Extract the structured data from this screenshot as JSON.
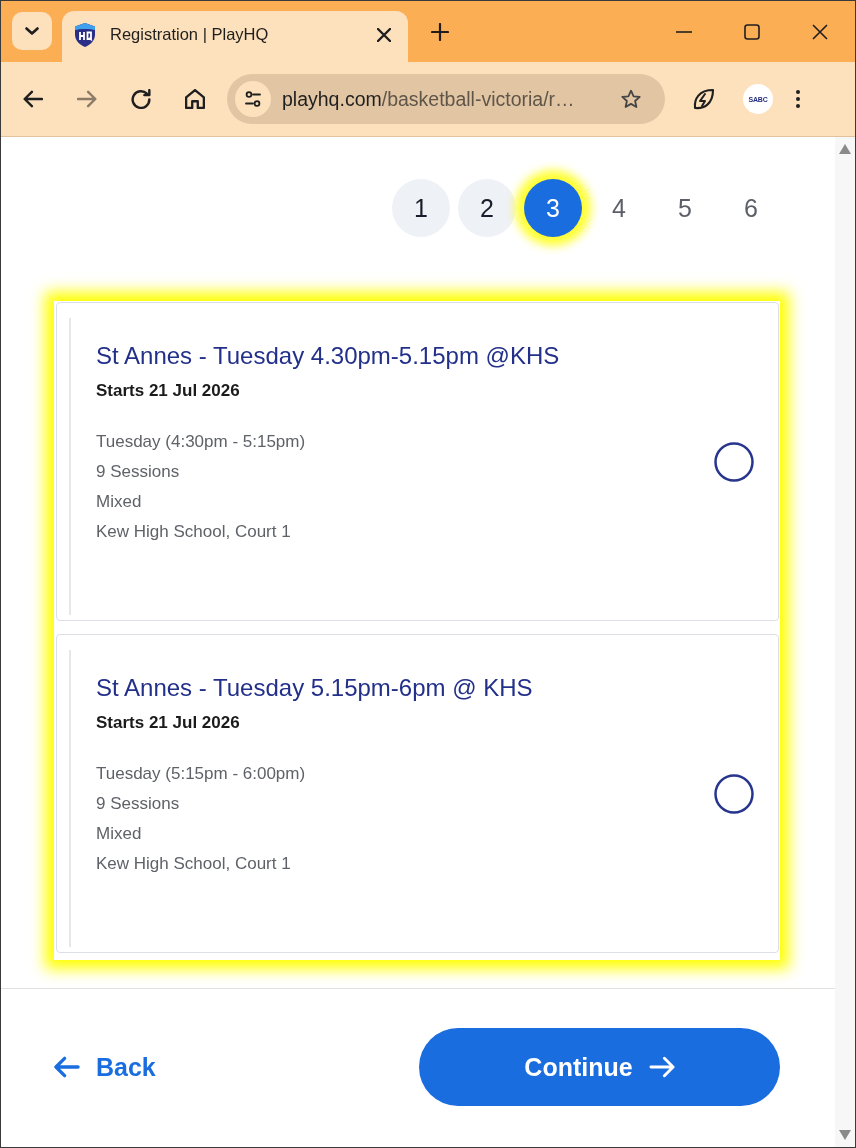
{
  "browser": {
    "tabs": [
      {
        "title": "Registration | PlayHQ",
        "selected": true
      }
    ],
    "toolbar": [
      {
        "kind": "back",
        "disabled": false
      },
      {
        "kind": "forward",
        "disabled": true
      },
      {
        "kind": "reload",
        "disabled": false
      },
      {
        "kind": "home",
        "disabled": false
      }
    ],
    "address": {
      "domain": "playhq.com",
      "path": "/basketball-victoria/r…"
    },
    "profile": {
      "label": "SABC"
    }
  },
  "stepper": [
    {
      "label": "1",
      "selected": false,
      "completed": true,
      "highlighted": false
    },
    {
      "label": "2",
      "selected": false,
      "completed": true,
      "highlighted": false
    },
    {
      "label": "3",
      "selected": true,
      "completed": false,
      "highlighted": true
    },
    {
      "label": "4",
      "selected": false,
      "completed": false,
      "highlighted": false
    },
    {
      "label": "5",
      "selected": false,
      "completed": false,
      "highlighted": false
    },
    {
      "label": "6",
      "selected": false,
      "completed": false,
      "highlighted": false
    }
  ],
  "session_list": {
    "highlighted": true,
    "items": [
      {
        "title": "St Annes - Tuesday 4.30pm-5.15pm @KHS",
        "starts": "Starts 21 Jul 2026",
        "details": [
          "Tuesday (4:30pm - 5:15pm)",
          "9 Sessions",
          "Mixed",
          "Kew High School, Court 1"
        ],
        "selected": false
      },
      {
        "title": "St Annes - Tuesday 5.15pm-6pm @ KHS",
        "starts": "Starts 21 Jul 2026",
        "details": [
          "Tuesday (5:15pm - 6:00pm)",
          "9 Sessions",
          "Mixed",
          "Kew High School, Court 1"
        ],
        "selected": false
      }
    ]
  },
  "footer": {
    "back": "Back",
    "continue": "Continue"
  }
}
